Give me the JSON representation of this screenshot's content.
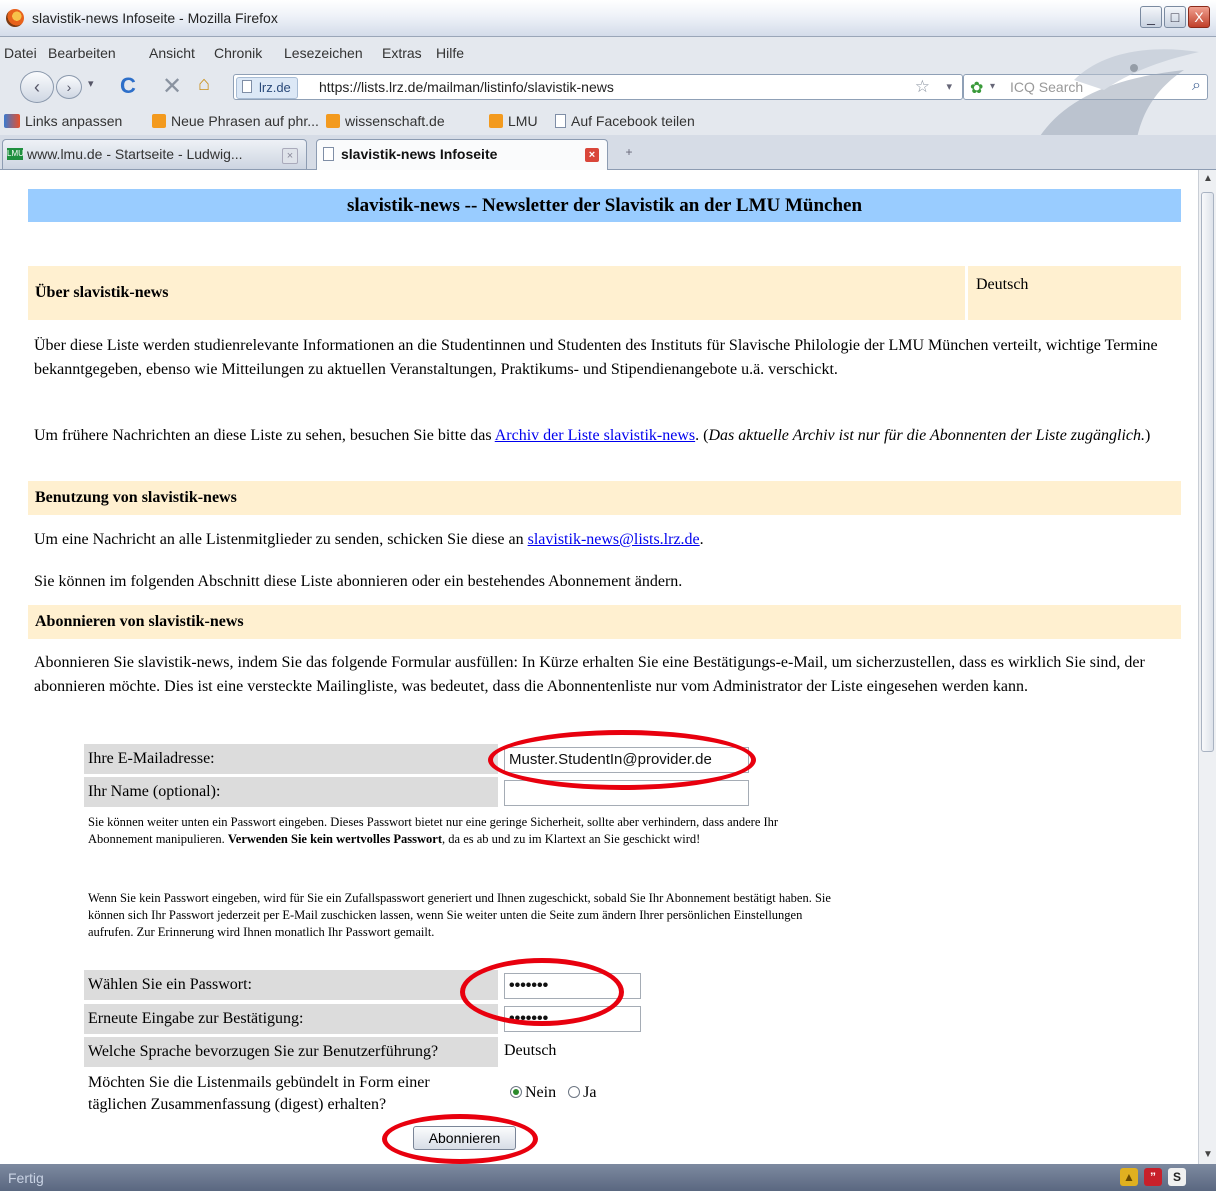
{
  "window": {
    "title": "slavistik-news Infoseite - Mozilla Firefox",
    "buttons": [
      "_",
      "□",
      "X"
    ]
  },
  "menu": [
    "Datei",
    "Bearbeiten",
    "Ansicht",
    "Chronik",
    "Lesezeichen",
    "Extras",
    "Hilfe"
  ],
  "nav": {
    "site_label": "lrz.de",
    "url": "https://lists.lrz.de/mailman/listinfo/slavistik-news",
    "search_placeholder": "ICQ Search"
  },
  "bookmarks": [
    "Links anpassen",
    "Neue Phrasen auf phr...",
    "wissenschaft.de",
    "LMU",
    "Auf Facebook teilen"
  ],
  "tabs": [
    {
      "label": "www.lmu.de - Startseite - Ludwig...",
      "active": false
    },
    {
      "label": "slavistik-news Infoseite",
      "active": true
    }
  ],
  "status": {
    "text": "Fertig"
  },
  "page": {
    "banner": "slavistik-news -- Newsletter der Slavistik an der LMU München",
    "about_heading": "Über slavistik-news",
    "language": "Deutsch",
    "about_text": "Über diese Liste werden studienrelevante Informationen an die Studentinnen und Studenten des Instituts für Slavische Philologie der LMU München verteilt, wichtige Termine bekanntgegeben, ebenso wie Mitteilungen zu aktuellen Veranstaltungen, Praktikums- und Stipendienangebote u.ä. verschickt.",
    "archive_pre": "Um frühere Nachrichten an diese Liste zu sehen, besuchen Sie bitte das ",
    "archive_link": "Archiv der Liste slavistik-news",
    "archive_post": ". (",
    "archive_note": "Das aktuelle Archiv ist nur für die Abonnenten der Liste zugänglich.",
    "archive_close": ")",
    "usage_heading": "Benutzung von slavistik-news",
    "usage_pre": "Um eine Nachricht an alle Listenmitglieder zu senden, schicken Sie diese an ",
    "usage_link": "slavistik-news@lists.lrz.de",
    "usage_post": ".",
    "subscribe_intro": "Sie können im folgenden Abschnitt diese Liste abonnieren oder ein bestehendes Abonnement ändern.",
    "subscribe_heading": "Abonnieren von slavistik-news",
    "subscribe_text": "Abonnieren Sie slavistik-news, indem Sie das folgende Formular ausfüllen: In Kürze erhalten Sie eine Bestätigungs-e-Mail, um sicherzustellen, dass es wirklich Sie sind, der abonnieren möchte. Dies ist eine versteckte Mailingliste, was bedeutet, dass die Abonnentenliste nur vom Administrator der Liste eingesehen werden kann."
  },
  "form": {
    "email_label": "Ihre E-Mailadresse:",
    "email_value": "Muster.StudentIn@provider.de",
    "name_label": "Ihr Name (optional):",
    "name_value": "",
    "note1_a": "Sie können weiter unten ein Passwort eingeben. Dieses Passwort bietet nur eine geringe Sicherheit, sollte aber verhindern, dass andere Ihr Abonnement manipulieren. ",
    "note1_b": "Verwenden Sie kein wertvolles Passwort",
    "note1_c": ", da es ab und zu im Klartext an Sie geschickt wird!",
    "note2": "Wenn Sie kein Passwort eingeben, wird für Sie ein Zufallspasswort generiert und Ihnen zugeschickt, sobald Sie Ihr Abonnement bestätigt haben. Sie können sich Ihr Passwort jederzeit per E-Mail zuschicken lassen, wenn Sie weiter unten die Seite zum ändern Ihrer persönlichen Einstellungen aufrufen. Zur Erinnerung wird Ihnen monatlich Ihr Passwort gemailt.",
    "pw_label": "Wählen Sie ein Passwort:",
    "pw_value": "•••••••",
    "pw2_label": "Erneute Eingabe zur Bestätigung:",
    "pw2_value": "•••••••",
    "lang_label": "Welche Sprache bevorzugen Sie zur Benutzerführung?",
    "lang_value": "Deutsch",
    "digest_label": "Möchten Sie die Listenmails gebündelt in Form einer täglichen Zusammenfassung (digest) erhalten?",
    "digest_no": "Nein",
    "digest_yes": "Ja",
    "digest_selected": "Nein",
    "submit": "Abonnieren"
  },
  "colors": {
    "banner": "#99ccff",
    "section": "#fff0d0",
    "form_label_bg": "#dcdcdc",
    "highlight": "#e8000e",
    "link": "#0000ee"
  }
}
